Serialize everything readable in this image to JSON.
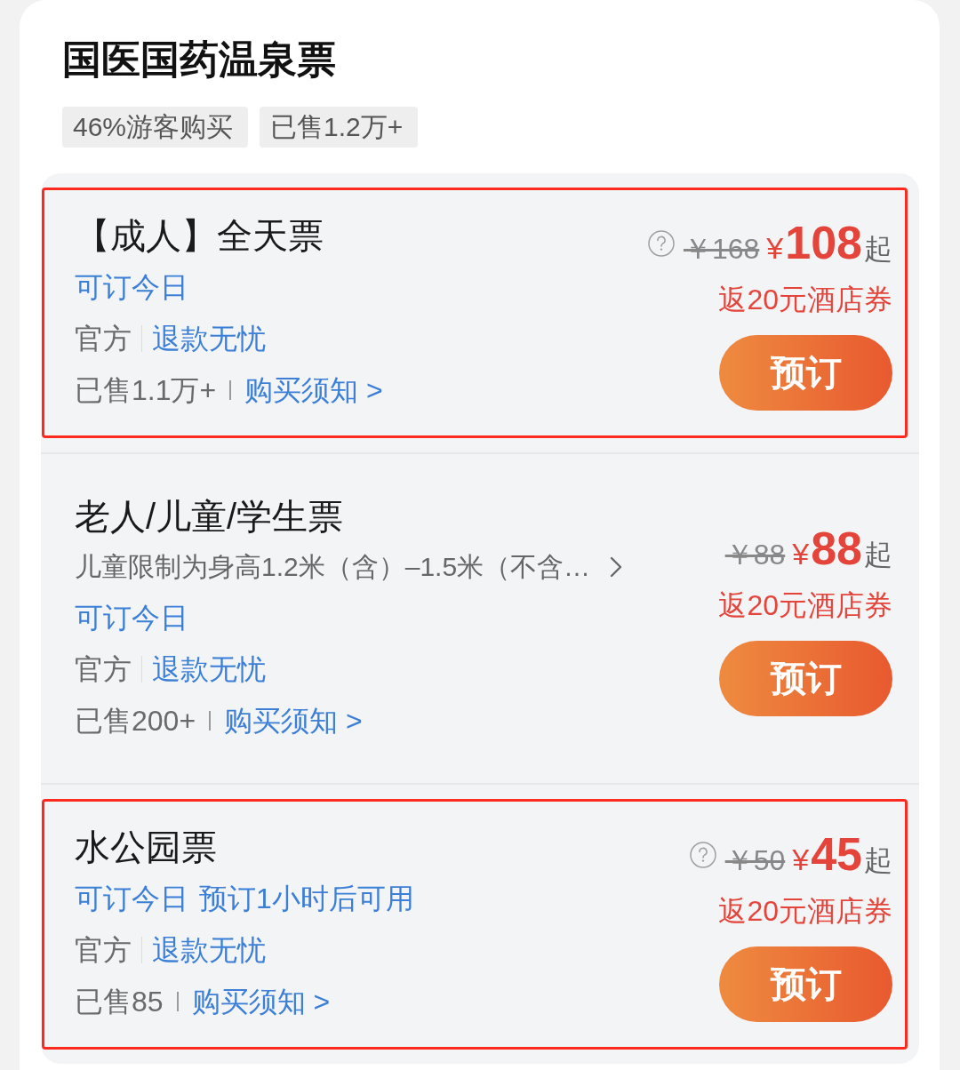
{
  "product": {
    "title": "国医国药温泉票",
    "tags": [
      "46%游客购买",
      "已售1.2万+"
    ]
  },
  "tickets": [
    {
      "name": "【成人】全天票",
      "highlighted": true,
      "availability": [
        "可订今日"
      ],
      "supplier": "官方",
      "refund": "退款无忧",
      "sold": "已售1.1万+",
      "notes_link": "购买须知 >",
      "help_icon": true,
      "original_price": "￥168",
      "currency": "¥",
      "price": "108",
      "price_suffix": "起",
      "coupon": "返20元酒店券",
      "button": "预订"
    },
    {
      "name": "老人/儿童/学生票",
      "highlighted": false,
      "description": "儿童限制为身高1.2米（含）–1.5米（不含…",
      "availability": [
        "可订今日"
      ],
      "supplier": "官方",
      "refund": "退款无忧",
      "sold": "已售200+",
      "notes_link": "购买须知 >",
      "help_icon": false,
      "original_price": "￥88",
      "currency": "¥",
      "price": "88",
      "price_suffix": "起",
      "coupon": "返20元酒店券",
      "button": "预订"
    },
    {
      "name": "水公园票",
      "highlighted": true,
      "availability": [
        "可订今日",
        "预订1小时后可用"
      ],
      "supplier": "官方",
      "refund": "退款无忧",
      "sold": "已售85",
      "notes_link": "购买须知 >",
      "help_icon": true,
      "original_price": "￥50",
      "currency": "¥",
      "price": "45",
      "price_suffix": "起",
      "coupon": "返20元酒店券",
      "button": "预订"
    }
  ]
}
